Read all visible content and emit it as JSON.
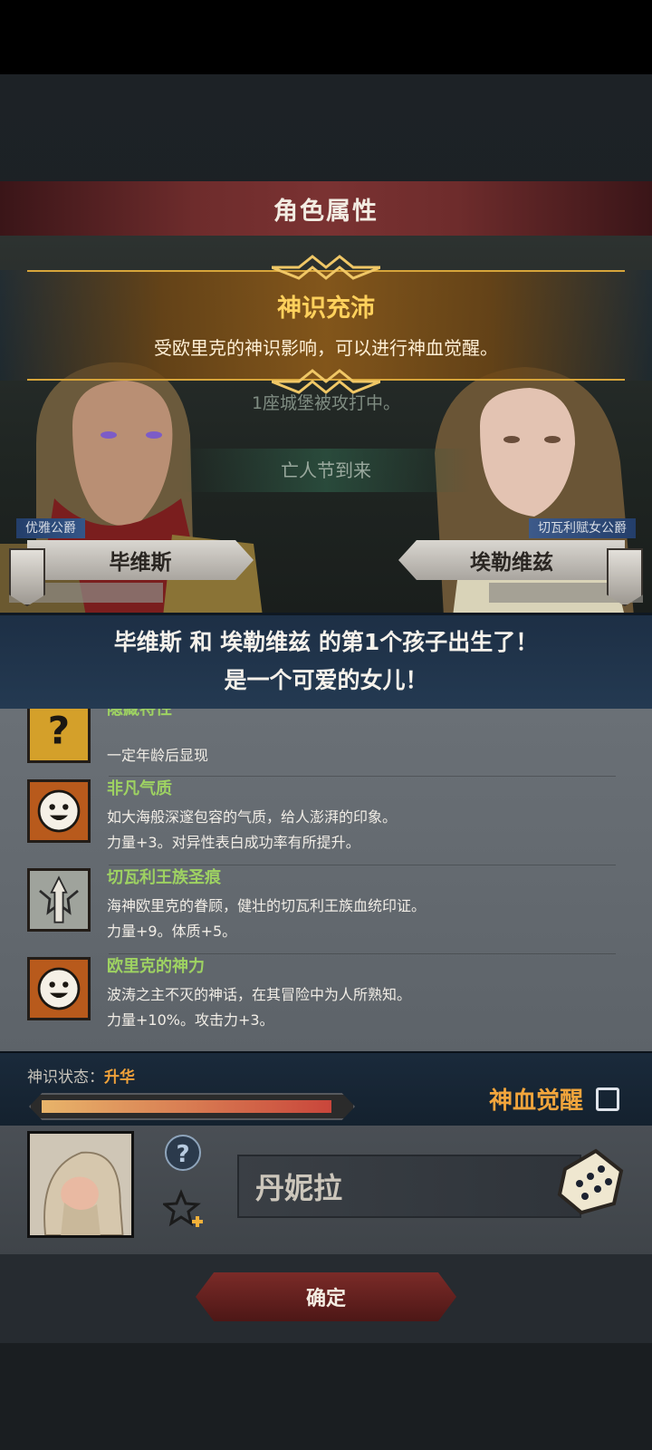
{
  "header": {
    "title": "角色属性"
  },
  "banner": {
    "title": "神识充沛",
    "subtitle": "受欧里克的神识影响，可以进行神血觉醒。"
  },
  "news": [
    "1座城堡被攻打中。",
    "亡人节到来"
  ],
  "parents": {
    "father": {
      "title": "优雅公爵",
      "name": "毕维斯"
    },
    "mother": {
      "title": "切瓦利赋女公爵",
      "name": "埃勒维兹"
    }
  },
  "birth": {
    "line1": "毕维斯 和 埃勒维兹 的第1个孩子出生了！",
    "line2": "是一个可爱的女儿！"
  },
  "traits": [
    {
      "icon": "question-icon",
      "name": "隐藏特性",
      "desc": "一定年龄后显现",
      "effect": ""
    },
    {
      "icon": "smile-icon",
      "name": "非凡气质",
      "desc": "如大海般深邃包容的气质，给人澎湃的印象。",
      "effect": "力量+3。对异性表白成功率有所提升。"
    },
    {
      "icon": "trident-crest-icon",
      "name": "切瓦利王族圣痕",
      "desc": "海神欧里克的眷顾，健壮的切瓦利王族血统印证。",
      "effect": "力量+9。体质+5。"
    },
    {
      "icon": "smile-icon",
      "name": "欧里克的神力",
      "desc": "波涛之主不灭的神话，在其冒险中为人所熟知。",
      "effect": "力量+10%。攻击力+3。"
    }
  ],
  "divine": {
    "label": "神识状态：",
    "value": "升华",
    "progress": 0.97,
    "awaken_label": "神血觉醒",
    "awaken_checked": false
  },
  "child": {
    "name": "丹妮拉",
    "help_glyph": "?",
    "avatar": "swaddled-baby"
  },
  "actions": {
    "confirm_label": "确定"
  },
  "colors": {
    "trait_name": "#9ed262",
    "accent_orange": "#f2a53c",
    "banner_title": "#ffd15c"
  }
}
